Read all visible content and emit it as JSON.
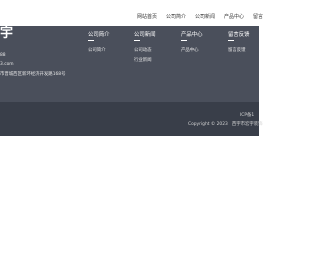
{
  "top_nav": {
    "items": [
      "网站首页",
      "公司简介",
      "公司新闻",
      "产品中心",
      "留言"
    ]
  },
  "footer": {
    "logo_text": "宇",
    "contact": {
      "line1": "88",
      "line2": "3.com",
      "line3": "市晋城西区新环经济开发路168号"
    },
    "columns": [
      {
        "title": "公司简介",
        "links": [
          "公司简介"
        ]
      },
      {
        "title": "公司新闻",
        "links": [
          "公司动态",
          "行业新闻"
        ]
      },
      {
        "title": "产品中心",
        "links": [
          "产品中心"
        ]
      },
      {
        "title": "留言反馈",
        "links": [
          "留言反馈"
        ]
      }
    ]
  },
  "bottom": {
    "icp": "ICP备1",
    "copyright": "Copyright © 2023",
    "company": "西宇市宏宇装饰"
  }
}
